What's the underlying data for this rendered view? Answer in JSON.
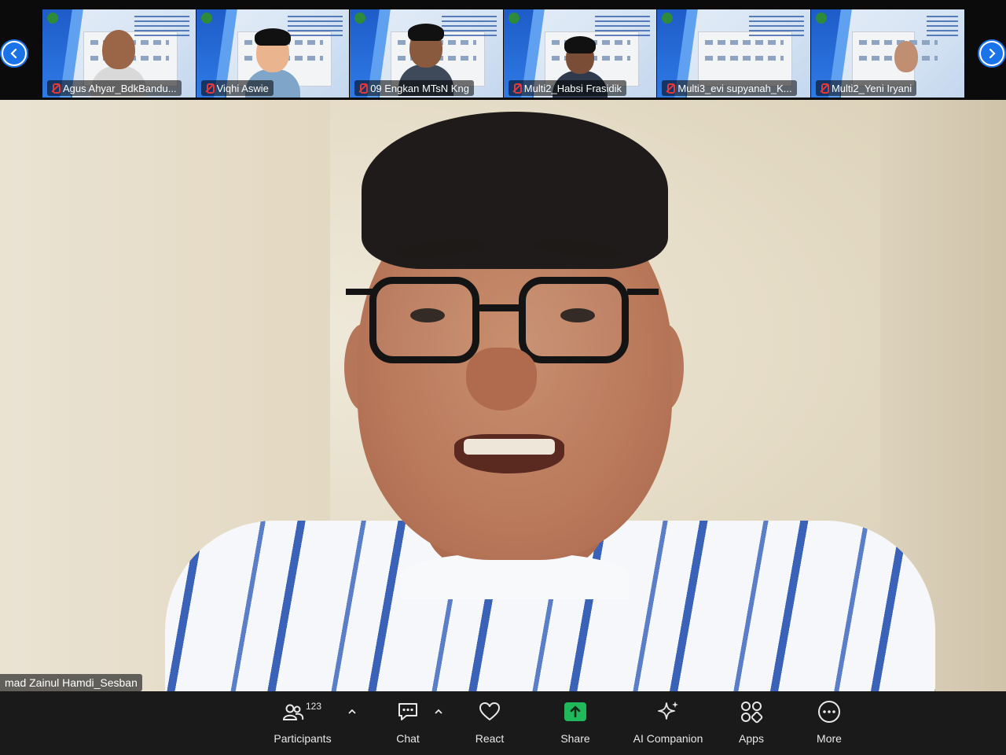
{
  "participants_strip": {
    "tiles": [
      {
        "name": "Agus Ahyar_BdkBandu..."
      },
      {
        "name": "Viqhi Aswie"
      },
      {
        "name": "09 Engkan MTsN Kng"
      },
      {
        "name": "Multi2_Habsi Frasidik"
      },
      {
        "name": "Multi3_evi supyanah_K..."
      },
      {
        "name": "Multi2_Yeni Iryani"
      }
    ]
  },
  "main_video": {
    "speaker_name": "mad Zainul Hamdi_Sesban"
  },
  "toolbar": {
    "participants_label": "Participants",
    "participants_count": "123",
    "chat_label": "Chat",
    "react_label": "React",
    "share_label": "Share",
    "ai_label": "AI Companion",
    "apps_label": "Apps",
    "more_label": "More"
  },
  "colors": {
    "accent": "#1a73e8",
    "share_green": "#1fb85a",
    "mic_muted": "#e03a3a",
    "toolbar_bg": "#1a1a1a"
  }
}
